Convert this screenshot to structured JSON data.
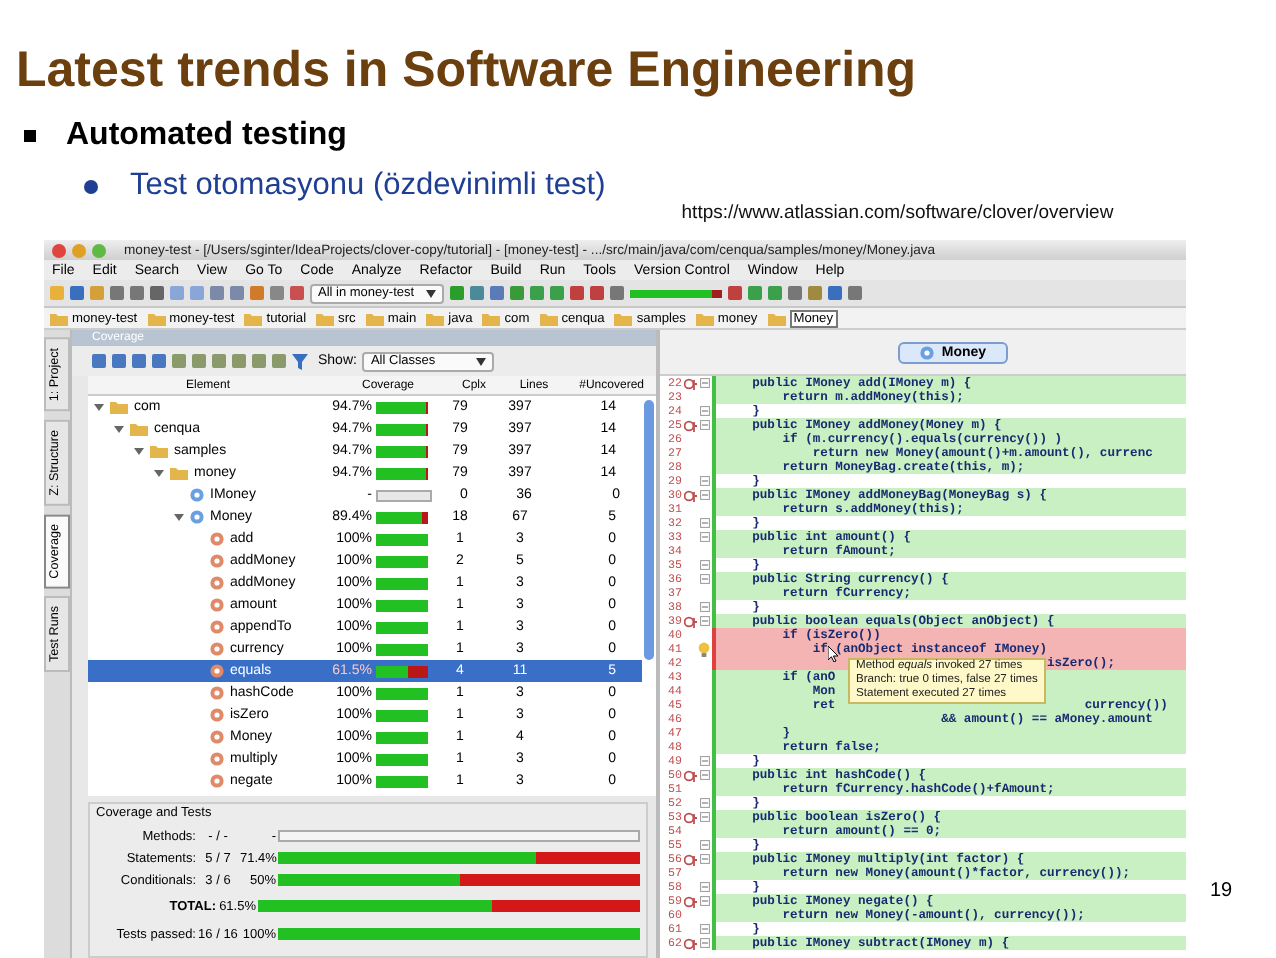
{
  "slide": {
    "title": "Latest trends in Software Engineering",
    "bullet": "Automated testing",
    "sub_bullet": "Test otomasyonu (özdevinimli test)",
    "source_url": "https://www.atlassian.com/software/clover/overview",
    "page_number": "19"
  },
  "ide": {
    "window_title": "money-test - [/Users/sginter/IdeaProjects/clover-copy/tutorial] - [money-test] - .../src/main/java/com/cenqua/samples/money/Money.java",
    "menu": [
      "File",
      "Edit",
      "Search",
      "View",
      "Go To",
      "Code",
      "Analyze",
      "Refactor",
      "Build",
      "Run",
      "Tools",
      "Version Control",
      "Window",
      "Help"
    ],
    "toolbar": {
      "run_config": "All in money-test",
      "coverage_meter": {
        "level": 0.88
      }
    },
    "breadcrumb": [
      {
        "label": "money-test",
        "selected": false
      },
      {
        "label": "money-test",
        "selected": false
      },
      {
        "label": "tutorial",
        "selected": false
      },
      {
        "label": "src",
        "selected": false
      },
      {
        "label": "main",
        "selected": false
      },
      {
        "label": "java",
        "selected": false
      },
      {
        "label": "com",
        "selected": false
      },
      {
        "label": "cenqua",
        "selected": false
      },
      {
        "label": "samples",
        "selected": false
      },
      {
        "label": "money",
        "selected": false
      },
      {
        "label": "Money",
        "selected": true
      }
    ],
    "tool_tabs": [
      {
        "label": "1: Project",
        "selected": false
      },
      {
        "label": "Z: Structure",
        "selected": false
      },
      {
        "label": "Coverage",
        "selected": true
      },
      {
        "label": "Test Runs",
        "selected": false
      }
    ],
    "coverage_panel": {
      "title": "Coverage",
      "show_label": "Show:",
      "show_value": "All Classes",
      "columns": [
        "Element",
        "Coverage",
        "Cplx",
        "Lines",
        "#Uncovered"
      ],
      "tree": [
        {
          "name": "com",
          "kind": "package",
          "coverage": "94.7%",
          "level": 0.947,
          "cplx": "79",
          "lines": "397",
          "uncovered": "14",
          "expanded": true,
          "selected": false,
          "children": [
            {
              "name": "cenqua",
              "kind": "package",
              "coverage": "94.7%",
              "level": 0.947,
              "cplx": "79",
              "lines": "397",
              "uncovered": "14",
              "expanded": true,
              "selected": false,
              "children": [
                {
                  "name": "samples",
                  "kind": "package",
                  "coverage": "94.7%",
                  "level": 0.947,
                  "cplx": "79",
                  "lines": "397",
                  "uncovered": "14",
                  "expanded": true,
                  "selected": false,
                  "children": [
                    {
                      "name": "money",
                      "kind": "package",
                      "coverage": "94.7%",
                      "level": 0.947,
                      "cplx": "79",
                      "lines": "397",
                      "uncovered": "14",
                      "expanded": true,
                      "selected": false,
                      "children": [
                        {
                          "name": "IMoney",
                          "kind": "class",
                          "coverage": "-",
                          "cplx": "0",
                          "lines": "36",
                          "uncovered": "0",
                          "selected": false
                        },
                        {
                          "name": "Money",
                          "kind": "class",
                          "coverage": "89.4%",
                          "level": 0.894,
                          "cplx": "18",
                          "lines": "67",
                          "uncovered": "5",
                          "expanded": true,
                          "selected": false,
                          "children": [
                            {
                              "name": "add",
                              "kind": "method",
                              "coverage": "100%",
                              "level": 1,
                              "cplx": "1",
                              "lines": "3",
                              "uncovered": "0",
                              "selected": false
                            },
                            {
                              "name": "addMoney",
                              "kind": "method",
                              "coverage": "100%",
                              "level": 1,
                              "cplx": "2",
                              "lines": "5",
                              "uncovered": "0",
                              "selected": false
                            },
                            {
                              "name": "addMoney",
                              "kind": "method",
                              "coverage": "100%",
                              "level": 1,
                              "cplx": "1",
                              "lines": "3",
                              "uncovered": "0",
                              "selected": false
                            },
                            {
                              "name": "amount",
                              "kind": "method",
                              "coverage": "100%",
                              "level": 1,
                              "cplx": "1",
                              "lines": "3",
                              "uncovered": "0",
                              "selected": false
                            },
                            {
                              "name": "appendTo",
                              "kind": "method",
                              "coverage": "100%",
                              "level": 1,
                              "cplx": "1",
                              "lines": "3",
                              "uncovered": "0",
                              "selected": false
                            },
                            {
                              "name": "currency",
                              "kind": "method",
                              "coverage": "100%",
                              "level": 1,
                              "cplx": "1",
                              "lines": "3",
                              "uncovered": "0",
                              "selected": false
                            },
                            {
                              "name": "equals",
                              "kind": "method",
                              "coverage": "61.5%",
                              "level": 0.615,
                              "cplx": "4",
                              "lines": "11",
                              "uncovered": "5",
                              "selected": true
                            },
                            {
                              "name": "hashCode",
                              "kind": "method",
                              "coverage": "100%",
                              "level": 1,
                              "cplx": "1",
                              "lines": "3",
                              "uncovered": "0",
                              "selected": false
                            },
                            {
                              "name": "isZero",
                              "kind": "method",
                              "coverage": "100%",
                              "level": 1,
                              "cplx": "1",
                              "lines": "3",
                              "uncovered": "0",
                              "selected": false
                            },
                            {
                              "name": "Money",
                              "kind": "method",
                              "coverage": "100%",
                              "level": 1,
                              "cplx": "1",
                              "lines": "4",
                              "uncovered": "0",
                              "selected": false
                            },
                            {
                              "name": "multiply",
                              "kind": "method",
                              "coverage": "100%",
                              "level": 1,
                              "cplx": "1",
                              "lines": "3",
                              "uncovered": "0",
                              "selected": false
                            },
                            {
                              "name": "negate",
                              "kind": "method",
                              "coverage": "100%",
                              "level": 1,
                              "cplx": "1",
                              "lines": "3",
                              "uncovered": "0",
                              "selected": false
                            }
                          ]
                        }
                      ]
                    }
                  ]
                }
              ]
            }
          ]
        }
      ],
      "summary": {
        "title": "Coverage and Tests",
        "rows": [
          {
            "label": "Methods:",
            "count": "- / -",
            "percent": "-",
            "kind": "empty"
          },
          {
            "label": "Statements:",
            "count": "5 / 7",
            "percent": "71.4%",
            "level": 0.714,
            "kind": "bar"
          },
          {
            "label": "Conditionals:",
            "count": "3 / 6",
            "percent": "50%",
            "level": 0.5,
            "kind": "bar"
          },
          {
            "label": "TOTAL:",
            "percent": "61.5%",
            "level": 0.615,
            "kind": "total"
          },
          {
            "label": "Tests passed:",
            "count": "16 / 16",
            "percent": "100%",
            "level": 1,
            "kind": "tests"
          }
        ]
      }
    },
    "editor": {
      "tab": "Money",
      "lines": [
        {
          "num": "22",
          "code": "    public IMoney add(IMoney m) {",
          "covered": true,
          "missed": false,
          "override": true,
          "fold": true
        },
        {
          "num": "23",
          "code": "        return m.addMoney(this);",
          "covered": true,
          "missed": false,
          "override": false,
          "fold": false
        },
        {
          "num": "24",
          "code": "    }",
          "covered": false,
          "missed": false,
          "override": false,
          "fold": true
        },
        {
          "num": "25",
          "code": "    public IMoney addMoney(Money m) {",
          "covered": true,
          "missed": false,
          "override": true,
          "fold": true
        },
        {
          "num": "26",
          "code": "        if (m.currency().equals(currency()) )",
          "covered": true,
          "missed": false,
          "override": false,
          "fold": false
        },
        {
          "num": "27",
          "code": "            return new Money(amount()+m.amount(), currenc",
          "covered": true,
          "missed": false,
          "override": false,
          "fold": false
        },
        {
          "num": "28",
          "code": "        return MoneyBag.create(this, m);",
          "covered": true,
          "missed": false,
          "override": false,
          "fold": false
        },
        {
          "num": "29",
          "code": "    }",
          "covered": false,
          "missed": false,
          "override": false,
          "fold": true
        },
        {
          "num": "30",
          "code": "    public IMoney addMoneyBag(MoneyBag s) {",
          "covered": true,
          "missed": false,
          "override": true,
          "fold": true
        },
        {
          "num": "31",
          "code": "        return s.addMoney(this);",
          "covered": true,
          "missed": false,
          "override": false,
          "fold": false
        },
        {
          "num": "32",
          "code": "    }",
          "covered": false,
          "missed": false,
          "override": false,
          "fold": true
        },
        {
          "num": "33",
          "code": "    public int amount() {",
          "covered": true,
          "missed": false,
          "override": false,
          "fold": true
        },
        {
          "num": "34",
          "code": "        return fAmount;",
          "covered": true,
          "missed": false,
          "override": false,
          "fold": false
        },
        {
          "num": "35",
          "code": "    }",
          "covered": false,
          "missed": false,
          "override": false,
          "fold": true
        },
        {
          "num": "36",
          "code": "    public String currency() {",
          "covered": true,
          "missed": false,
          "override": false,
          "fold": true
        },
        {
          "num": "37",
          "code": "        return fCurrency;",
          "covered": true,
          "missed": false,
          "override": false,
          "fold": false
        },
        {
          "num": "38",
          "code": "    }",
          "covered": false,
          "missed": false,
          "override": false,
          "fold": true
        },
        {
          "num": "39",
          "code": "    public boolean equals(Object anObject) {",
          "covered": true,
          "missed": false,
          "override": true,
          "fold": true
        },
        {
          "num": "40",
          "code": "        if (isZero())",
          "covered": false,
          "missed": true,
          "override": false,
          "fold": false
        },
        {
          "num": "41",
          "code": "            if (anObject instanceof IMoney)",
          "covered": false,
          "missed": true,
          "override": false,
          "fold": false
        },
        {
          "num": "42",
          "code": "                                           isZero();",
          "covered": false,
          "missed": true,
          "override": false,
          "fold": false
        },
        {
          "num": "43",
          "code": "        if (anO",
          "covered": true,
          "missed": false,
          "override": false,
          "fold": false
        },
        {
          "num": "44",
          "code": "            Mon",
          "covered": true,
          "missed": false,
          "override": false,
          "fold": false
        },
        {
          "num": "45",
          "code": "            ret                                 currency())",
          "covered": true,
          "missed": false,
          "override": false,
          "fold": false
        },
        {
          "num": "46",
          "code": "                             && amount() == aMoney.amount",
          "covered": true,
          "missed": false,
          "override": false,
          "fold": false
        },
        {
          "num": "47",
          "code": "        }",
          "covered": true,
          "missed": false,
          "override": false,
          "fold": false
        },
        {
          "num": "48",
          "code": "        return false;",
          "covered": true,
          "missed": false,
          "override": false,
          "fold": false
        },
        {
          "num": "49",
          "code": "    }",
          "covered": false,
          "missed": false,
          "override": false,
          "fold": true
        },
        {
          "num": "50",
          "code": "    public int hashCode() {",
          "covered": true,
          "missed": false,
          "override": true,
          "fold": true
        },
        {
          "num": "51",
          "code": "        return fCurrency.hashCode()+fAmount;",
          "covered": true,
          "missed": false,
          "override": false,
          "fold": false
        },
        {
          "num": "52",
          "code": "    }",
          "covered": false,
          "missed": false,
          "override": false,
          "fold": true
        },
        {
          "num": "53",
          "code": "    public boolean isZero() {",
          "covered": true,
          "missed": false,
          "override": true,
          "fold": true
        },
        {
          "num": "54",
          "code": "        return amount() == 0;",
          "covered": true,
          "missed": false,
          "override": false,
          "fold": false
        },
        {
          "num": "55",
          "code": "    }",
          "covered": false,
          "missed": false,
          "override": false,
          "fold": true
        },
        {
          "num": "56",
          "code": "    public IMoney multiply(int factor) {",
          "covered": true,
          "missed": false,
          "override": true,
          "fold": true
        },
        {
          "num": "57",
          "code": "        return new Money(amount()*factor, currency());",
          "covered": true,
          "missed": false,
          "override": false,
          "fold": false
        },
        {
          "num": "58",
          "code": "    }",
          "covered": false,
          "missed": false,
          "override": false,
          "fold": true
        },
        {
          "num": "59",
          "code": "    public IMoney negate() {",
          "covered": true,
          "missed": false,
          "override": true,
          "fold": true
        },
        {
          "num": "60",
          "code": "        return new Money(-amount(), currency());",
          "covered": true,
          "missed": false,
          "override": false,
          "fold": false
        },
        {
          "num": "61",
          "code": "    }",
          "covered": false,
          "missed": false,
          "override": false,
          "fold": true
        },
        {
          "num": "62",
          "code": "    public IMoney subtract(IMoney m) {",
          "covered": true,
          "missed": false,
          "override": true,
          "fold": true
        }
      ],
      "tooltip": [
        "Method *equals* invoked 27 times",
        "Branch: true 0 times, false 27 times",
        "Statement executed 27 times"
      ]
    }
  }
}
